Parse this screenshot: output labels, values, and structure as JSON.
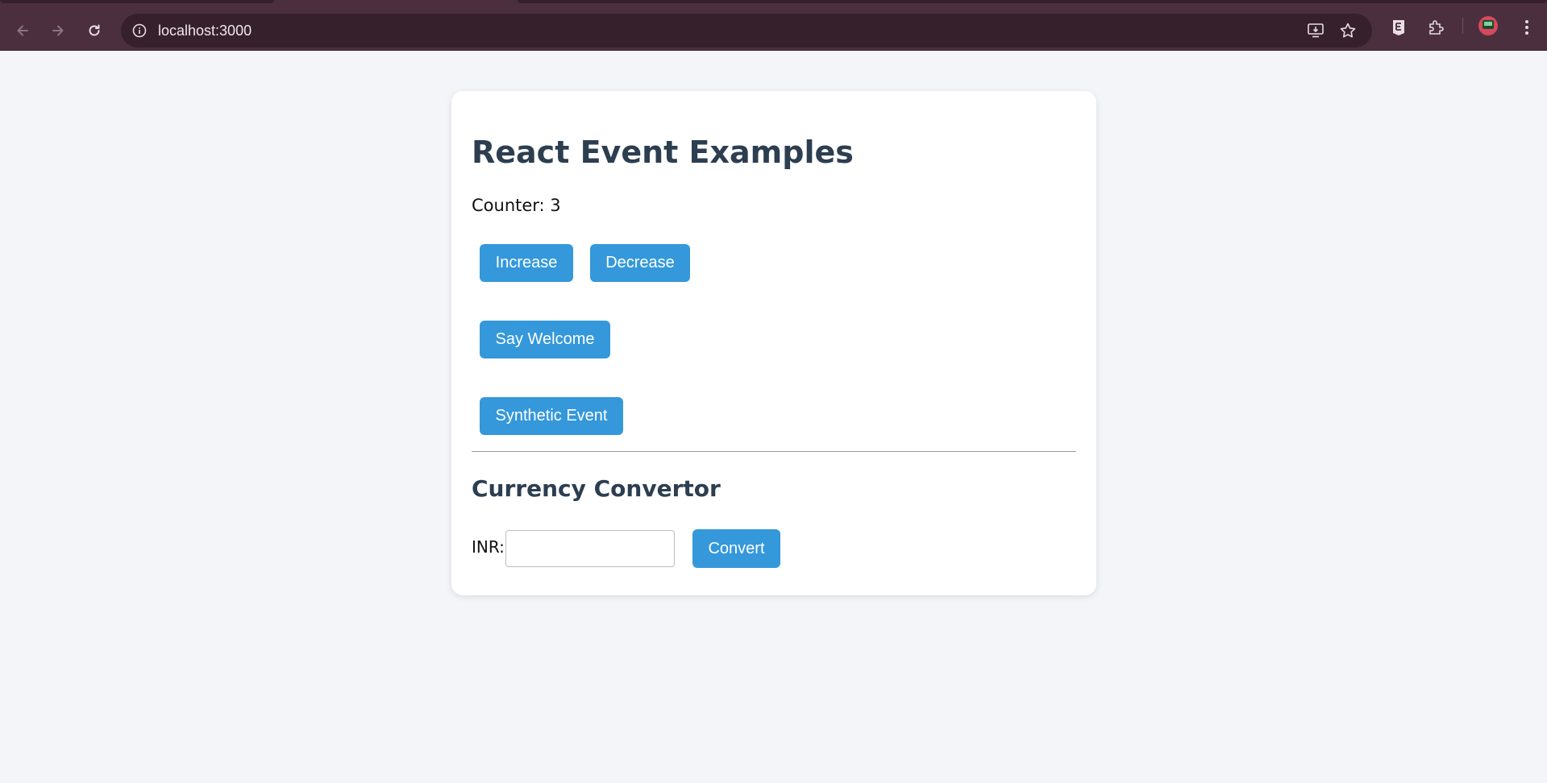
{
  "browser": {
    "url": "localhost:3000",
    "nav_icons": [
      "back-icon",
      "forward-icon",
      "reload-icon"
    ],
    "omnibox_icons": [
      "site-info-icon",
      "install-app-icon",
      "bookmark-star-icon"
    ],
    "toolbar_icons": [
      "extension-e-icon",
      "extensions-puzzle-icon",
      "profile-avatar",
      "menu-kebab-icon"
    ],
    "colors": {
      "frame": "#4b2f3f",
      "omnibox": "#36202c"
    }
  },
  "page": {
    "title": "React Event Examples",
    "counter_text": "Counter: 3",
    "buttons": {
      "increase": "Increase",
      "decrease": "Decrease",
      "say_welcome": "Say Welcome",
      "synthetic_event": "Synthetic Event",
      "convert": "Convert"
    },
    "currency": {
      "heading": "Currency Convertor",
      "inr_label": "INR:",
      "inr_value": ""
    },
    "colors": {
      "button": "#3498db",
      "heading": "#2c3e50",
      "background": "#f4f5f8"
    }
  }
}
